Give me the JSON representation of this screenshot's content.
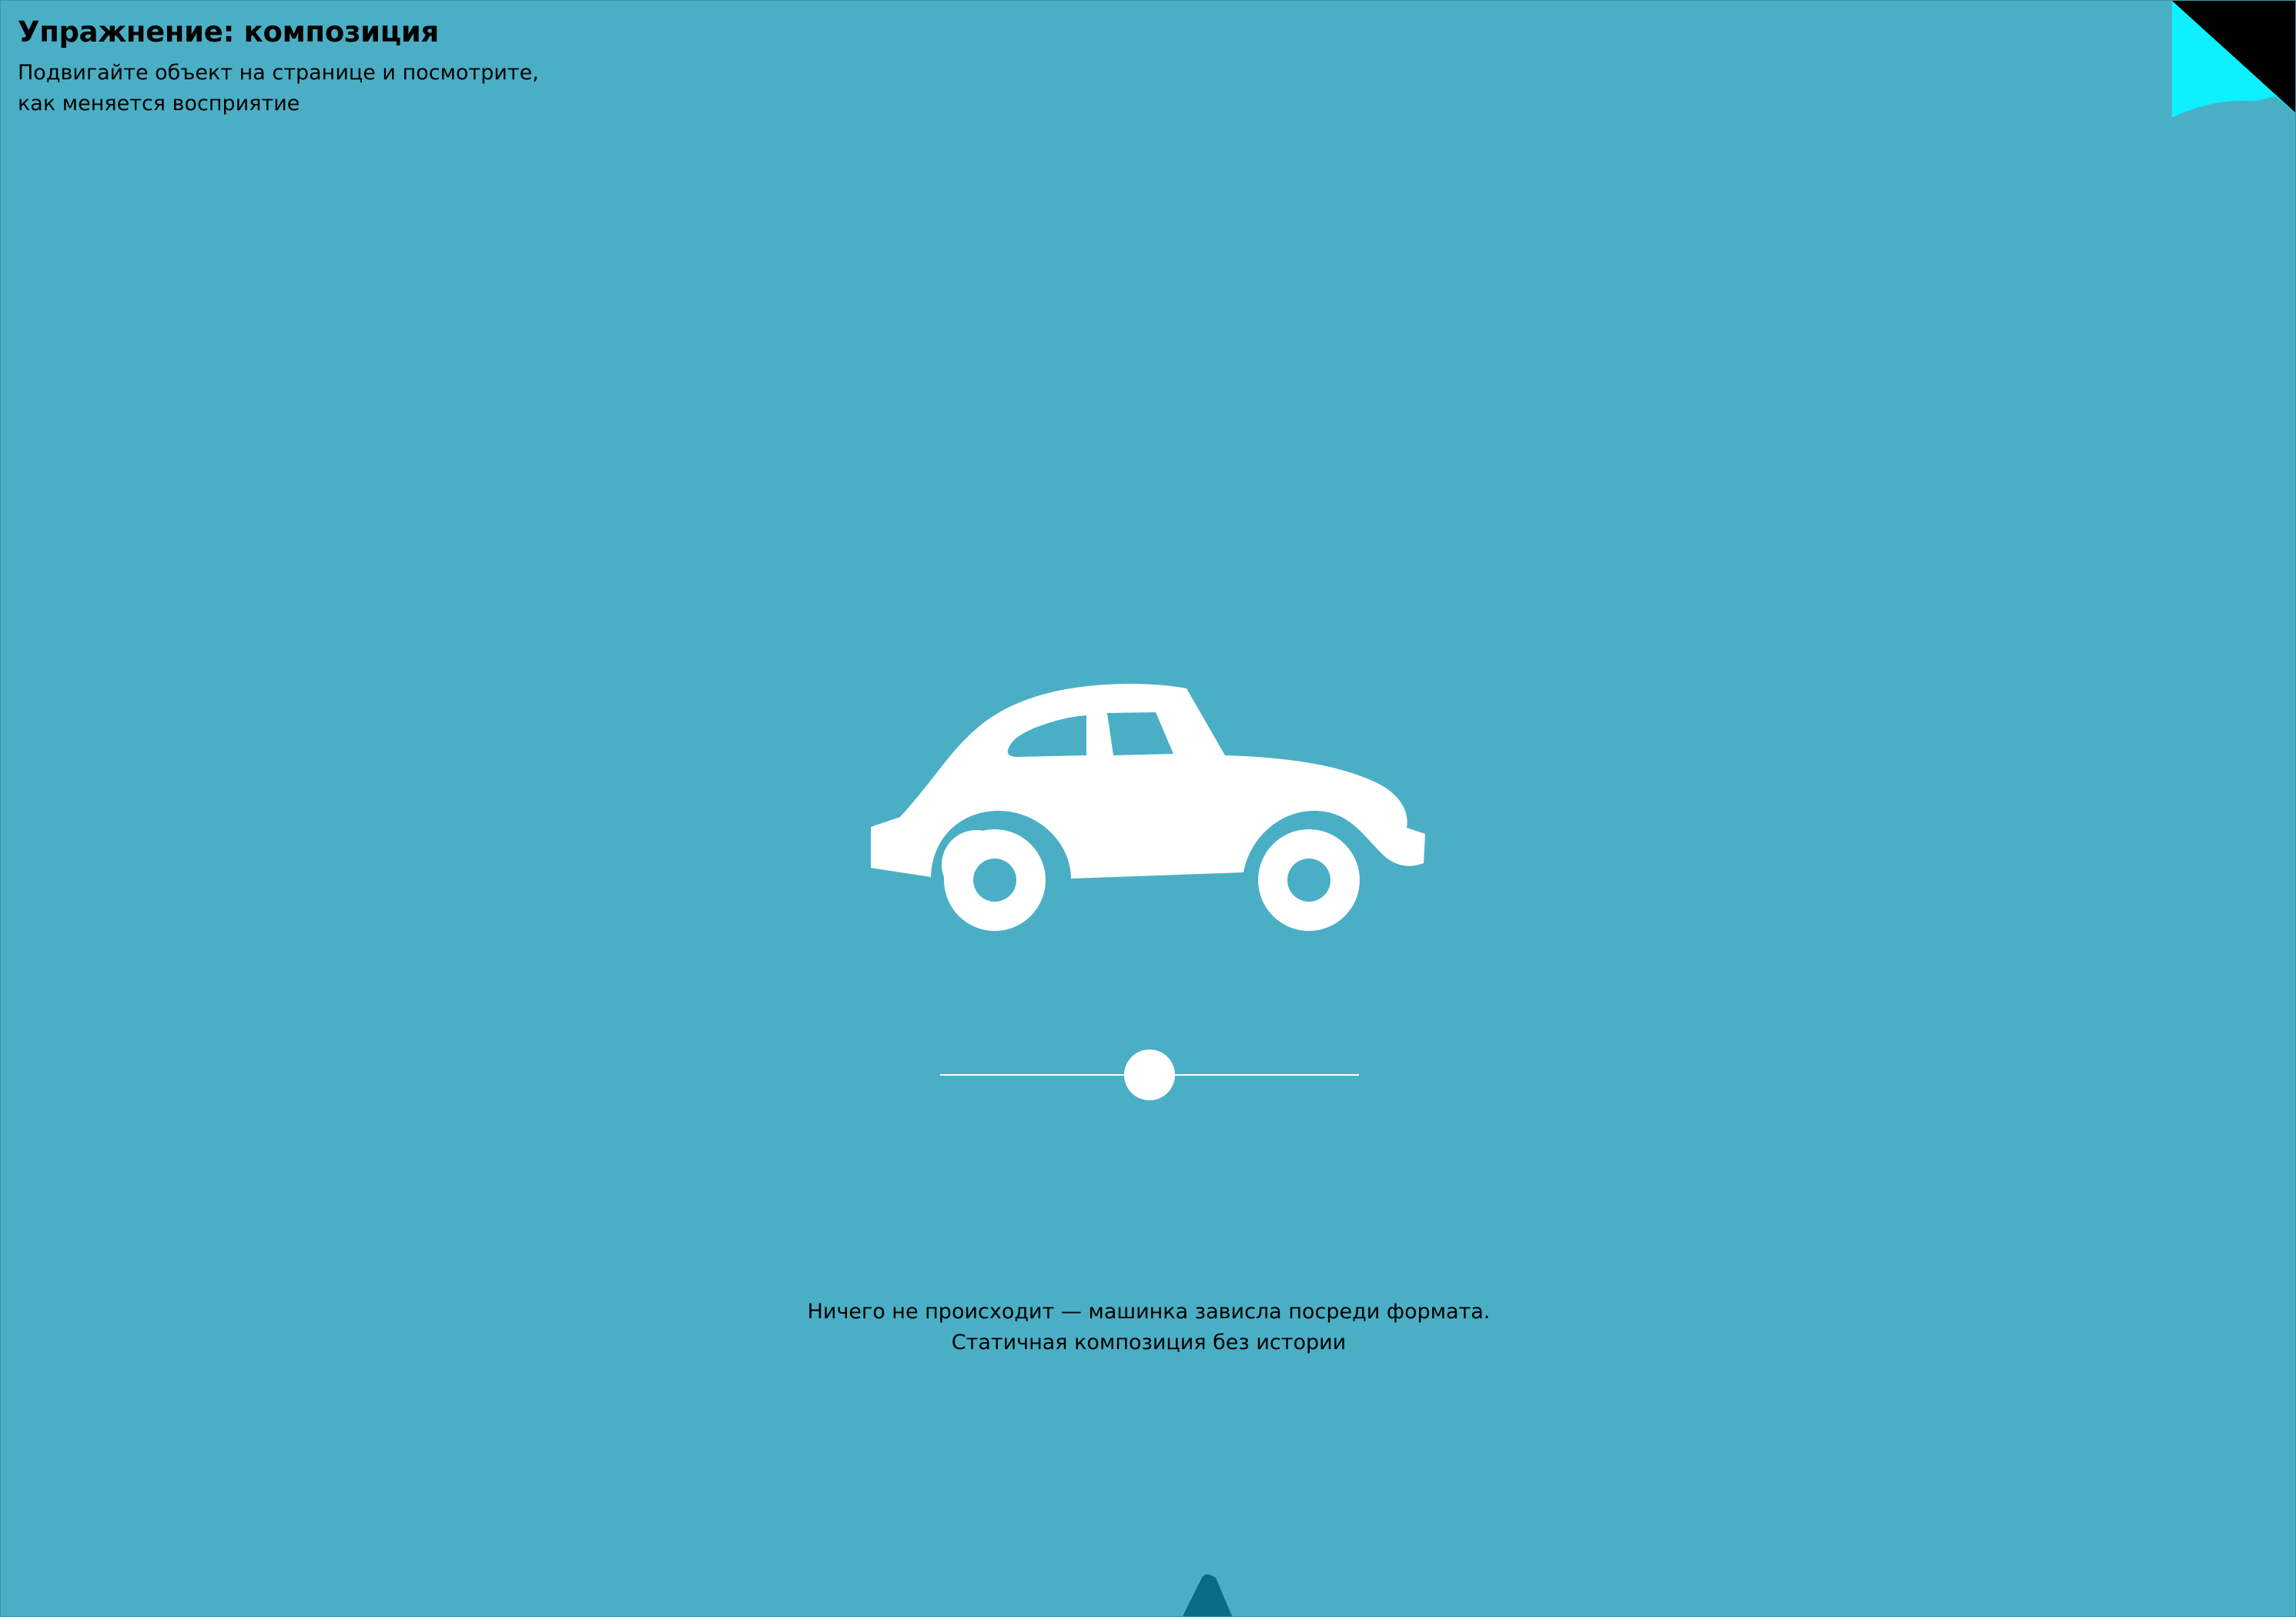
{
  "header": {
    "title": "Упражнение: композиция",
    "subtitle": "Подвигайте объект на странице и посмотрите,\nкак меняется восприятие"
  },
  "scene": {
    "background_color": "#4aafc5",
    "object_icon": "car-icon",
    "object_color": "#ffffff"
  },
  "slider": {
    "value": 0.5
  },
  "caption": {
    "line1": "Ничего не происходит — машинка зависла посреди формата.",
    "line2": "Статичная композиция без истории"
  },
  "corner": {
    "icon": "page-curl-icon",
    "colors": [
      "#000000",
      "#0ef0ff"
    ]
  },
  "bottom_marker": {
    "icon": "triangle-marker-icon",
    "color": "#066d85"
  }
}
